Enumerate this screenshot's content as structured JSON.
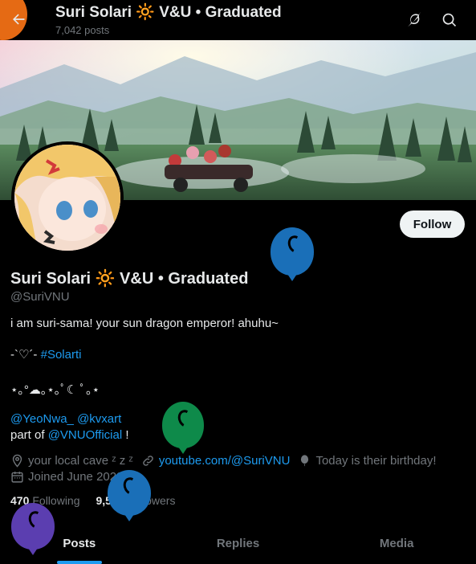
{
  "header": {
    "name": "Suri Solari 🔆 V&U • Graduated",
    "posts_count": "7,042 posts"
  },
  "profile": {
    "display_name": "Suri Solari 🔆 V&U • Graduated",
    "handle": "@SuriVNU",
    "follow_label": "Follow",
    "bio": {
      "line1": "i am suri-sama! your sun dragon emperor! ahuhu~",
      "line2_prefix": "-`♡´- ",
      "line2_hashtag": "#Solarti",
      "line3": "⋆｡°☁︎｡⋆｡ﾟ☾ ﾟ｡⋆",
      "mention1": "@YeoNwa_",
      "mention2": "@kvxart",
      "part_of_prefix": "part of ",
      "part_of_mention": "@VNUOfficial",
      "part_of_suffix": " !"
    },
    "location": "your local cave ᶻ z ᶻ",
    "website": "youtube.com/@SuriVNU",
    "birthday": "Today is their birthday!",
    "joined": "Joined June 2023"
  },
  "stats": {
    "following_count": "470",
    "following_label": "Following",
    "followers_count": "9,549",
    "followers_label": "Followers"
  },
  "tabs": [
    "Posts",
    "Replies",
    "Media"
  ],
  "colors": {
    "accent": "#1d9bf0",
    "background": "#000000",
    "text": "#e7e9ea",
    "muted": "#71767b",
    "balloon_blue": "#1a6fb8",
    "balloon_green": "#0e8a4a",
    "balloon_purple": "#5b3eb0",
    "balloon_orange": "#e56a14"
  }
}
